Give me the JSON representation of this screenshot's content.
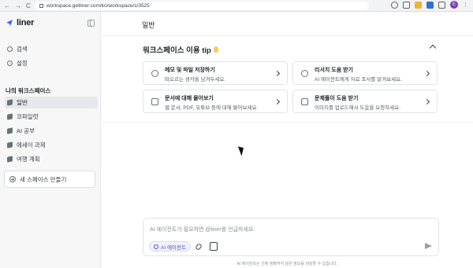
{
  "browser": {
    "url": "workspace.getliner.com/ko/workspace/s/3525",
    "nav_back": "←",
    "nav_forward": "→",
    "nav_reload": "C",
    "profile_initial": "E"
  },
  "sidebar": {
    "brand": "liner",
    "items": [
      {
        "label": "검색",
        "icon": "search-icon"
      },
      {
        "label": "설정",
        "icon": "gear-icon"
      }
    ],
    "workspaces_label": "나의 워크스페이스",
    "workspaces": [
      {
        "label": "일반",
        "active": true
      },
      {
        "label": "코파일럿",
        "active": false
      },
      {
        "label": "AI 공부",
        "active": false
      },
      {
        "label": "에세이 과제",
        "active": false
      },
      {
        "label": "여행 계획",
        "active": false
      }
    ],
    "new_space": "새 스페이스 만들기"
  },
  "main": {
    "page_title": "일반",
    "tip_title": "워크스페이스 이용 tip",
    "tips": [
      {
        "title": "메모 및 파일 저장하기",
        "desc": "떠오르는 생각을 남겨두세요."
      },
      {
        "title": "리서치 도움 받기",
        "desc": "AI 에이전트에게 자료 조사를 맡겨보세요."
      },
      {
        "title": "문서에 대해 물어보기",
        "desc": "웹 문서, PDF, 유튜브 등에 대해 물어보세요."
      },
      {
        "title": "문제풀이 도움 받기",
        "desc": "이미지를 업로드해서 도움을 요청하세요."
      }
    ],
    "composer_placeholder": "AI 에이전트가 필요하면 @liner를 언급하세요.",
    "agent_chip": "AI 에이전트",
    "disclaimer": "AI 에이전트는 간혹 정확하지 않은 정보를 생성할 수 있습니다."
  },
  "colors": {
    "accent": "#4b50c8",
    "brand": "#3d5afe",
    "profile": "#7b3fb2",
    "bulb": "#f5cf56"
  }
}
